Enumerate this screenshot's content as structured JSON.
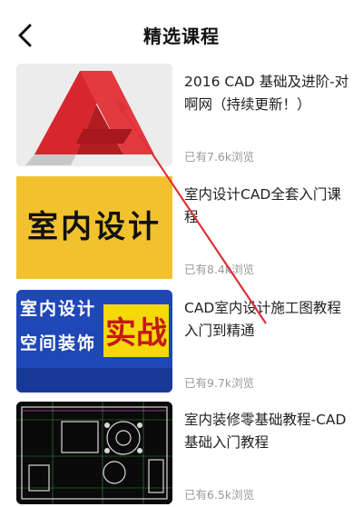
{
  "header": {
    "title": "精选课程",
    "back_icon": "chevron-left-icon"
  },
  "courses": [
    {
      "title": "2016 CAD 基础及进阶-对啊网（持续更新！）",
      "views": "已有7.6k浏览",
      "thumb_icon": "autocad-logo"
    },
    {
      "title": "室内设计CAD全套入门课程",
      "views": "已有8.4k浏览",
      "thumb_text": "室内设计"
    },
    {
      "title": "CAD室内设计施工图教程入门到精通",
      "views": "已有9.7k浏览",
      "thumb_text_left": [
        "室内设计",
        "空间装饰"
      ],
      "thumb_text_right": "实战"
    },
    {
      "title": "室内装修零基础教程-CAD基础入门教程",
      "views": "已有6.5k浏览",
      "thumb_icon": "cad-floorplan"
    }
  ],
  "colors": {
    "annotation_arrow": "#e0303a",
    "views_text": "#9a9a9a",
    "thumb2_bg": "#f2c22e",
    "thumb3_bg": "#1f47b8",
    "thumb3_accent": "#f5d90a",
    "autocad_red": "#d8262e"
  }
}
